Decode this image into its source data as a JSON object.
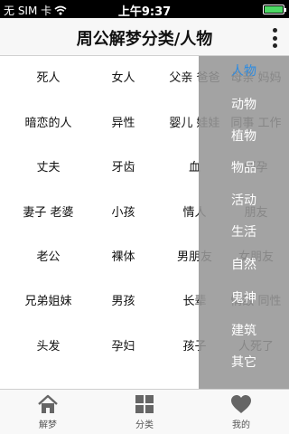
{
  "status_bar": {
    "carrier": "无 SIM 卡",
    "time": "上午9:37"
  },
  "nav": {
    "title": "周公解梦分类/人物",
    "more_icon": "more-vertical-icon"
  },
  "grid_rows": [
    [
      "死人",
      "女人",
      "父亲 爸爸",
      "母亲 妈妈"
    ],
    [
      "暗恋的人",
      "异性",
      "婴儿 娃娃",
      "同事 工作"
    ],
    [
      "丈夫",
      "牙齿",
      "血",
      "怀孕"
    ],
    [
      "妻子 老婆",
      "小孩",
      "情人",
      "朋友"
    ],
    [
      "老公",
      "裸体",
      "男朋友",
      "女朋友"
    ],
    [
      "兄弟姐妹",
      "男孩",
      "长辈",
      "情敌 同性"
    ],
    [
      "头发",
      "孕妇",
      "孩子",
      "人死了"
    ]
  ],
  "drawer": {
    "items": [
      "人物",
      "动物",
      "植物",
      "物品",
      "活动",
      "生活",
      "自然",
      "鬼神",
      "建筑",
      "其它"
    ],
    "active_index": 0,
    "active_color": "#2f8ce0"
  },
  "tab_bar": {
    "tabs": [
      {
        "label": "解梦",
        "icon": "home-icon"
      },
      {
        "label": "分类",
        "icon": "grid-icon"
      },
      {
        "label": "我的",
        "icon": "heart-icon"
      }
    ]
  }
}
